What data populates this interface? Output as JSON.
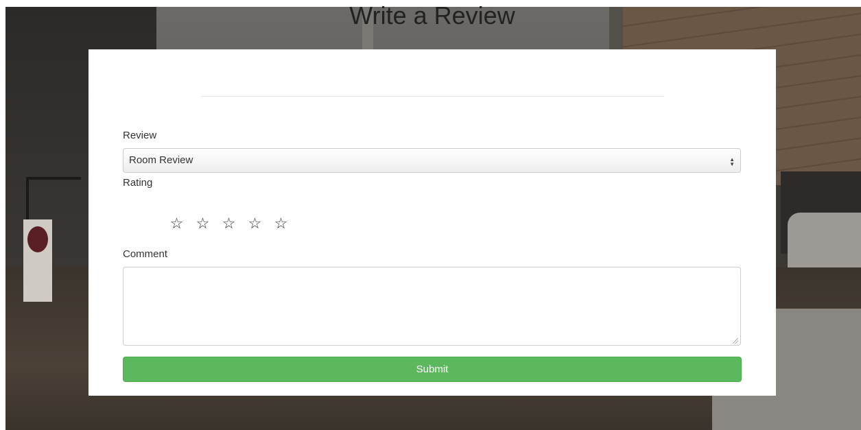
{
  "page": {
    "title": "Write a Review"
  },
  "form": {
    "review_label": "Review",
    "review_selected": "Room Review",
    "rating_label": "Rating",
    "rating": {
      "value": 0,
      "max": 5
    },
    "comment_label": "Comment",
    "comment_value": "",
    "submit_label": "Submit"
  },
  "icons": {
    "star": "☆",
    "select_arrows": "▲▼"
  },
  "colors": {
    "submit_bg": "#5cb85c",
    "card_bg": "#ffffff"
  }
}
